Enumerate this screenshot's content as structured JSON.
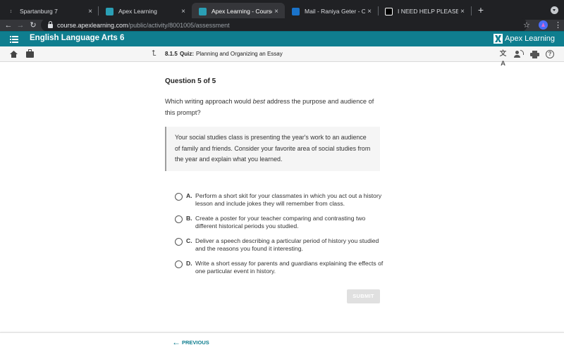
{
  "browser": {
    "tabs": [
      {
        "title": "Spartanburg 7",
        "icon": "spartanburg-favicon",
        "active": false
      },
      {
        "title": "Apex Learning",
        "icon": "apex-favicon",
        "active": false
      },
      {
        "title": "Apex Learning - Courses",
        "icon": "apex-favicon",
        "active": true
      },
      {
        "title": "Mail - Raniya Geter - Outlook",
        "icon": "outlook-favicon",
        "active": false
      },
      {
        "title": "I NEED HELP PLEASE HURRY -",
        "icon": "brainly-favicon",
        "active": false
      }
    ],
    "close_glyph": "×",
    "new_tab_glyph": "+",
    "back_glyph": "←",
    "forward_glyph": "→",
    "reload_glyph": "↻",
    "star_glyph": "☆",
    "menu_glyph": "⋮",
    "url_domain": "course.apexlearning.com",
    "url_path": "/public/activity/8001005/assessment"
  },
  "app": {
    "course_title": "English Language Arts 6",
    "brand_name": "Apex Learning",
    "up_glyph": "⮤",
    "quiz_id": "8.1.5",
    "quiz_label": "Quiz:",
    "quiz_name": "Planning and Organizing an Essay",
    "translate_glyph": "文A",
    "help_glyph": "?"
  },
  "question": {
    "number_label": "Question 5 of 5",
    "text_before": "Which writing approach would ",
    "text_emphasis": "best",
    "text_after": " address the purpose and audience of this prompt?",
    "prompt": "Your social studies class is presenting the year's work to an audience of family and friends. Consider your favorite area of social studies from the year and explain what you learned.",
    "options": [
      {
        "letter": "A.",
        "text": "Perform a short skit for your classmates in which you act out a history lesson and include jokes they will remember from class.",
        "selected": false
      },
      {
        "letter": "B.",
        "text": "Create a poster for your teacher comparing and contrasting two different historical periods you studied.",
        "selected": false
      },
      {
        "letter": "C.",
        "text": "Deliver a speech describing a particular period of history you studied and the reasons you found it interesting.",
        "selected": false
      },
      {
        "letter": "D.",
        "text": "Write a short essay for parents and guardians explaining the effects of one particular event in history.",
        "selected": false
      }
    ],
    "submit_label": "SUBMIT"
  },
  "footer": {
    "previous_label": "PREVIOUS",
    "previous_glyph": "←"
  },
  "colors": {
    "brand_teal": "#0f7e8f",
    "browser_dark": "#202124",
    "submit_disabled": "#e0e0e0"
  }
}
